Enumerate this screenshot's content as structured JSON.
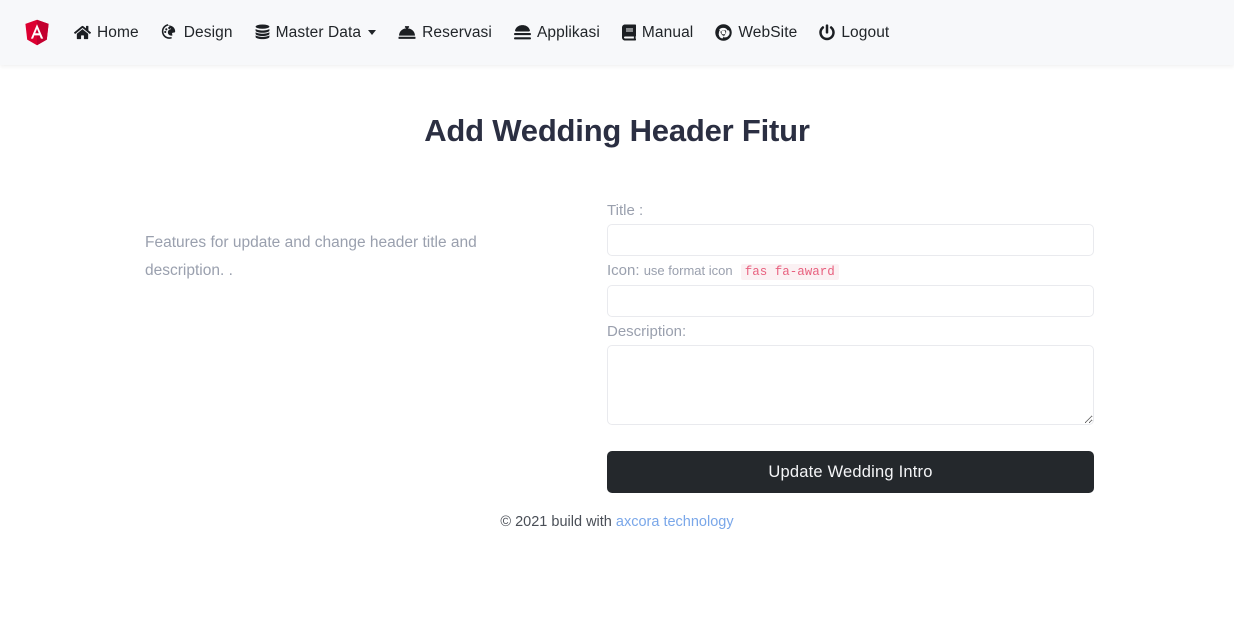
{
  "navbar": {
    "brand": {
      "icon": "angular-shield-logo",
      "color": "#dd0031"
    },
    "items": [
      {
        "icon": "home-icon",
        "label": "Home",
        "caret": false
      },
      {
        "icon": "palette-icon",
        "label": "Design",
        "caret": false
      },
      {
        "icon": "database-icon",
        "label": "Master Data",
        "caret": true
      },
      {
        "icon": "concierge-bell-icon",
        "label": "Reservasi",
        "caret": false
      },
      {
        "icon": "layer-stack-icon",
        "label": "Applikasi",
        "caret": false
      },
      {
        "icon": "book-icon",
        "label": "Manual",
        "caret": false
      },
      {
        "icon": "chrome-globe-icon",
        "label": "WebSite",
        "caret": false
      },
      {
        "icon": "power-icon",
        "label": "Logout",
        "caret": false
      }
    ]
  },
  "page": {
    "title": "Add Wedding Header Fitur",
    "lead": "Features for update and change header title and description. ."
  },
  "form": {
    "title_label": "Title :",
    "title_value": "",
    "title_placeholder": "",
    "icon_label": "Icon:",
    "icon_hint": "use format icon",
    "icon_code": "fas fa-award",
    "icon_value": "",
    "icon_placeholder": "",
    "description_label": "Description:",
    "description_value": "",
    "description_placeholder": "",
    "submit_label": "Update Wedding Intro"
  },
  "footer": {
    "text": "© 2021 build with",
    "link_label": "axcora technology"
  },
  "colors": {
    "navbar_bg": "#f7f8fa",
    "title": "#2b2f42",
    "muted": "#9aa0ae",
    "button_bg": "#24282c",
    "code": "#e8617f",
    "link": "#7aa7e9",
    "brand_red": "#dd0031"
  }
}
